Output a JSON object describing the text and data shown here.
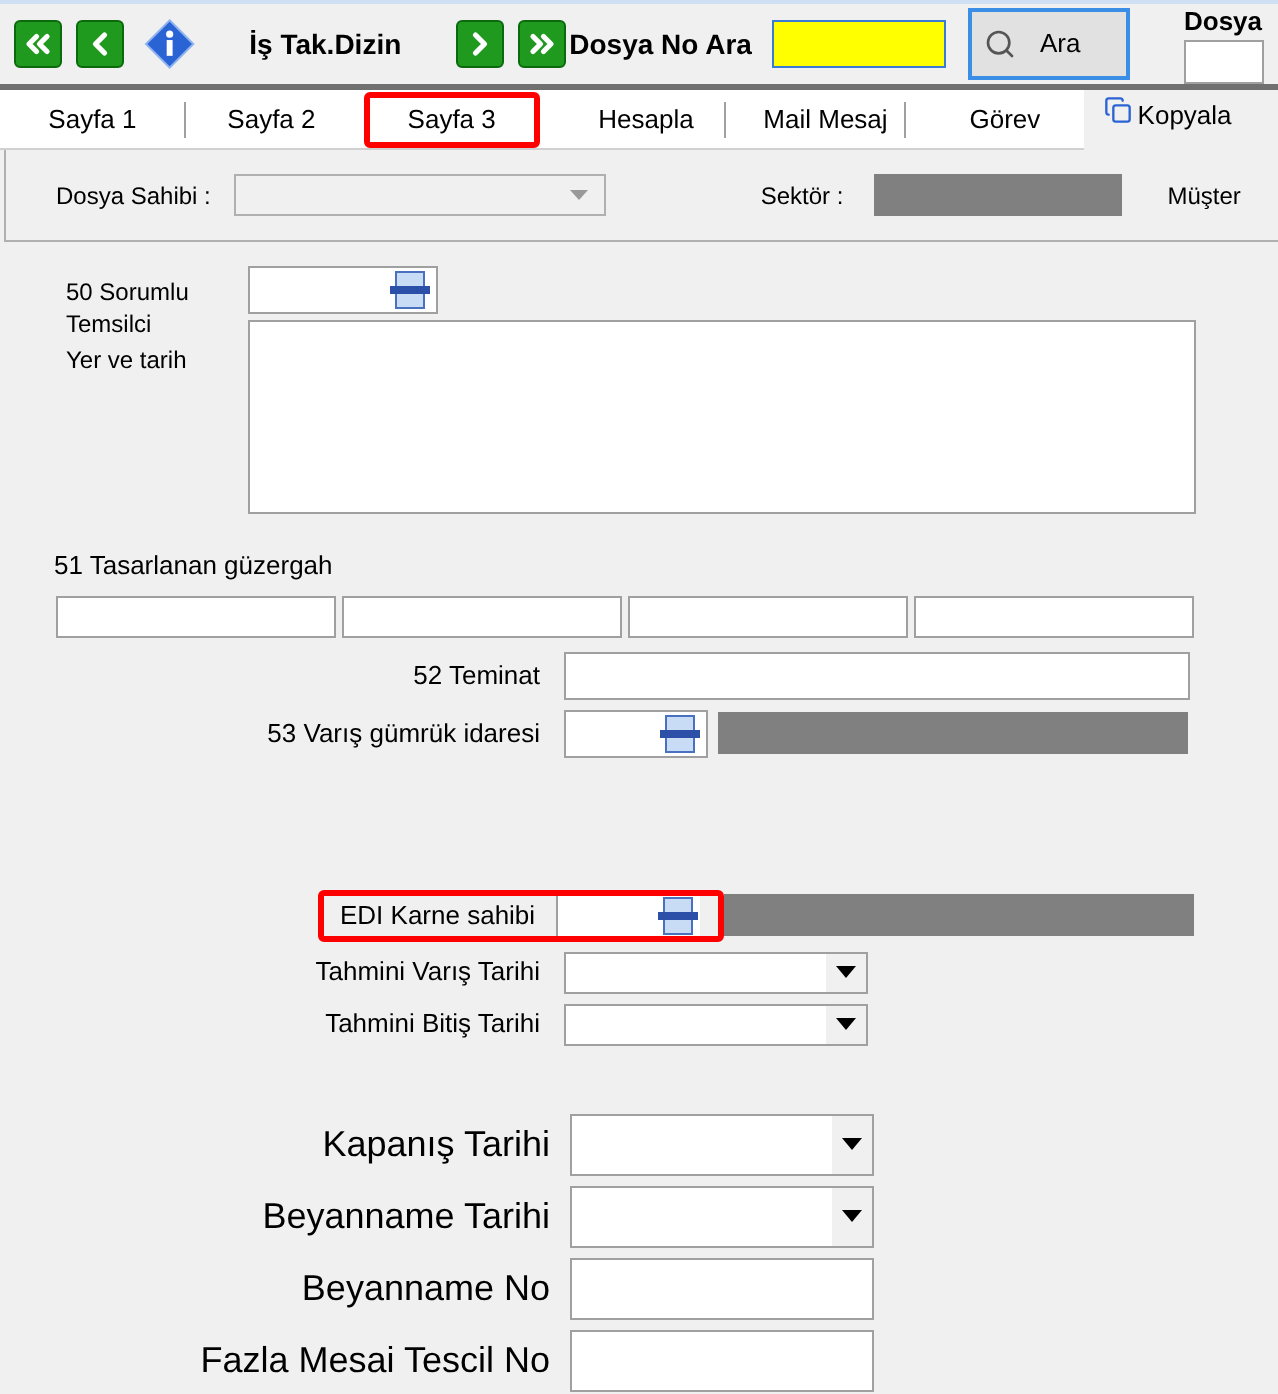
{
  "toolbar": {
    "items": [
      {
        "kind": "first"
      },
      {
        "kind": "prev"
      },
      {
        "kind": "info"
      },
      {
        "kind": "label",
        "text": "İş Tak.Dizin"
      },
      {
        "kind": "next"
      },
      {
        "kind": "last"
      }
    ],
    "search_label": "Dosya No Ara",
    "search_button": "Ara",
    "right_label": "Dosya"
  },
  "tabs": [
    {
      "label": "Sayfa 1",
      "highlighted": false
    },
    {
      "label": "Sayfa 2",
      "highlighted": false
    },
    {
      "label": "Sayfa 3",
      "highlighted": true
    },
    {
      "label": "Hesapla",
      "highlighted": false
    },
    {
      "label": "Mail Mesaj",
      "highlighted": false
    },
    {
      "label": "Görev",
      "highlighted": false
    }
  ],
  "copy_button": "Kopyala",
  "header": {
    "owner_label": "Dosya Sahibi :",
    "sector_label": "Sektör :",
    "customer_label": "Müşter"
  },
  "responsible": {
    "label": "50 Sorumlu Temsilci",
    "place_label": "Yer ve tarih"
  },
  "route": {
    "label": "51 Tasarlanan güzergah"
  },
  "rows": [
    {
      "kind": "text",
      "label": "52 Teminat",
      "highlighted": false
    },
    {
      "kind": "picker",
      "label": "53 Varış gümrük idaresi",
      "highlighted": false
    },
    {
      "kind": "spacer"
    },
    {
      "kind": "picker",
      "label": "EDI Karne sahibi",
      "highlighted": true
    },
    {
      "kind": "combo",
      "label": "Tahmini Varış Tarihi",
      "highlighted": false
    },
    {
      "kind": "combo",
      "label": "Tahmini Bitiş Tarihi",
      "highlighted": false
    },
    {
      "kind": "spacer"
    },
    {
      "kind": "combo",
      "label": "Kapanış Tarihi",
      "large": true,
      "highlighted": false
    },
    {
      "kind": "combo",
      "label": "Beyanname Tarihi",
      "large": true,
      "highlighted": false
    },
    {
      "kind": "text",
      "label": "Beyanname No",
      "large": true,
      "highlighted": false
    },
    {
      "kind": "text",
      "label": "Fazla Mesai Tescil No",
      "large": true,
      "highlighted": false
    }
  ]
}
